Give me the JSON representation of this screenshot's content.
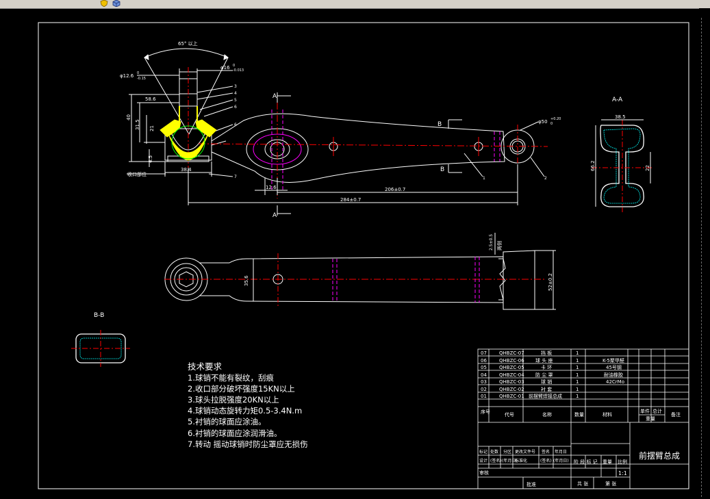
{
  "toolbar": {
    "icons": [
      "shield-icon",
      "cube-icon"
    ]
  },
  "colors": {
    "background": "#000000",
    "line": "#ffffff",
    "accent_yellow": "#ffff00",
    "accent_magenta": "#ff00ff",
    "accent_red": "#ff0000",
    "accent_cyan": "#00ffff",
    "accent_green": "#00ff00"
  },
  "drawing": {
    "dims_main": {
      "angle": "65° 以上",
      "d1": "φ12.6",
      "d1_tol_up": "0",
      "d1_tol_dn": "-0.15",
      "d2": "φ16",
      "d2_tol_up": "0",
      "d2_tol_dn": "-0.013",
      "l58": "58.6",
      "l40": "40",
      "l31": "31.5",
      "l21": "21",
      "l45": "4.5",
      "l384": "38.4",
      "d3": "φ50",
      "d3_tol_up": "+0.20",
      "d3_tol_dn": "0",
      "l126": "12.6",
      "l206": "206±0.7",
      "l284": "284±0.7",
      "weld_label": "收口部位"
    },
    "balloons": [
      "1",
      "2",
      "3",
      "4",
      "5",
      "6",
      "7"
    ],
    "section_labels": {
      "a": "A",
      "b": "B",
      "aa": "A-A",
      "bb": "B-B"
    },
    "dims_aa": {
      "w": "38.5",
      "h": "66.2",
      "t": "22"
    },
    "dims_plan": {
      "h": "35.6",
      "h2": "52±0.2",
      "small": "2.5±0.5",
      "tag": "两侧"
    }
  },
  "notes": {
    "title": "技术要求",
    "items": [
      "1.球销不能有裂纹，刮痕",
      "2.收口部分破坏强度15KN以上",
      "3.球头拉脱强度20KN以上",
      "4.球销动态旋转力矩0.5-3.4N.m",
      "5.衬销的球面应涂油。",
      "6.衬销的球面应涂润滑油。",
      "7.转动 摇动球销时防尘罩应无损伤"
    ]
  },
  "bom": {
    "rows": [
      {
        "no": "07",
        "code": "QHBZC-07",
        "name": "挡 板",
        "qty": "1",
        "material": "",
        "mass": "",
        "total": "",
        "remark": ""
      },
      {
        "no": "06",
        "code": "QHBZC-06",
        "name": "球 头 座",
        "qty": "1",
        "material": "K-5聚甲醛",
        "mass": "",
        "total": "",
        "remark": ""
      },
      {
        "no": "05",
        "code": "QHBZC-05",
        "name": "卡 环",
        "qty": "1",
        "material": "45号钢",
        "mass": "",
        "total": "",
        "remark": ""
      },
      {
        "no": "04",
        "code": "QHBZC-04",
        "name": "防 尘 罩",
        "qty": "1",
        "material": "耐油橡胶",
        "mass": "",
        "total": "",
        "remark": ""
      },
      {
        "no": "03",
        "code": "QHBZC-03",
        "name": "球 销",
        "qty": "1",
        "material": "42CrMo",
        "mass": "",
        "total": "",
        "remark": ""
      },
      {
        "no": "02",
        "code": "QHBZC-02",
        "name": "衬 套",
        "qty": "1",
        "material": "",
        "mass": "",
        "total": "",
        "remark": ""
      },
      {
        "no": "01",
        "code": "QHBZC-01",
        "name": "前摆臂焊接总成",
        "qty": "1",
        "material": "",
        "mass": "",
        "total": "",
        "remark": ""
      }
    ],
    "headers": {
      "no": "序号",
      "code": "代号",
      "name": "名称",
      "qty": "数量",
      "material": "材料",
      "mass": "单件",
      "total": "总计",
      "weight": "重量",
      "remark": "备注"
    }
  },
  "title_block": {
    "drawing_title": "前摆臂总成",
    "scale_label": "比例",
    "scale": "1:1",
    "stage_label": "阶 段 标 记",
    "weight_label": "重量",
    "sheets": "共   张",
    "sheet_no": "第   张",
    "rev_row": [
      "标记",
      "处数",
      "分区",
      "更改文件号",
      "签名",
      "年月日"
    ],
    "design_row": [
      "设计",
      "(签名)",
      "(年月日)",
      "标准化",
      "(签名)",
      "(年月日)"
    ],
    "review": "审核",
    "process": "工艺",
    "approve": "批准"
  }
}
